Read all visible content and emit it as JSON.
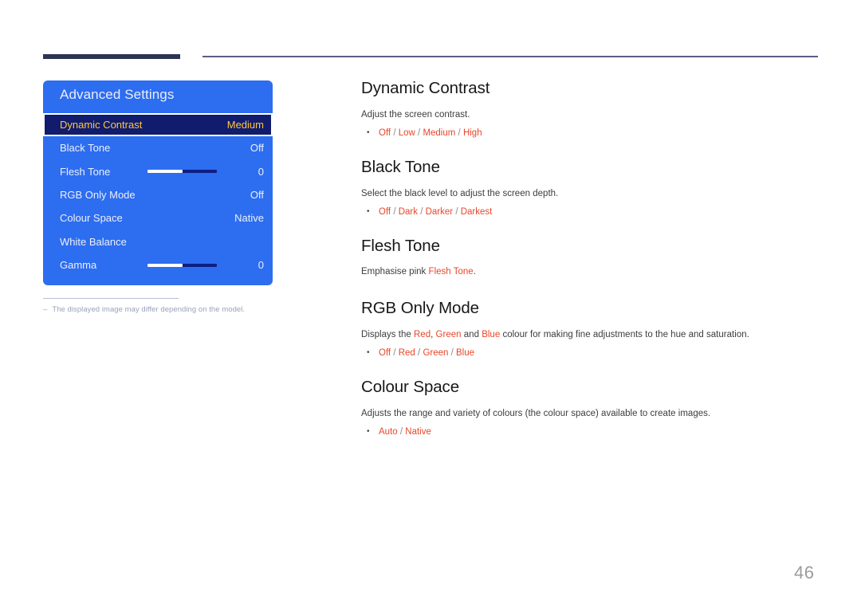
{
  "header": {
    "rule_thick_color": "#2e3553",
    "rule_thin_color": "#5a5f7d"
  },
  "osd": {
    "title": "Advanced Settings",
    "panel_color": "#2d6df0",
    "selected_bg_color": "#111c6e",
    "selected_text_color": "#ffc83d",
    "scroll_indicator": "chevron-down",
    "rows": [
      {
        "label": "Dynamic Contrast",
        "value": "Medium",
        "type": "value",
        "selected": true
      },
      {
        "label": "Black Tone",
        "value": "Off",
        "type": "value",
        "selected": false
      },
      {
        "label": "Flesh Tone",
        "value": "0",
        "type": "slider",
        "fill_percent": 50,
        "selected": false
      },
      {
        "label": "RGB Only Mode",
        "value": "Off",
        "type": "value",
        "selected": false
      },
      {
        "label": "Colour Space",
        "value": "Native",
        "type": "value",
        "selected": false
      },
      {
        "label": "White Balance",
        "value": "",
        "type": "value",
        "selected": false
      },
      {
        "label": "Gamma",
        "value": "0",
        "type": "slider",
        "fill_percent": 50,
        "selected": false
      }
    ]
  },
  "footnote": {
    "dash": "‒",
    "text": "The displayed image may differ depending on the model."
  },
  "content": {
    "accent_color": "#e8462a",
    "sections": [
      {
        "heading": "Dynamic Contrast",
        "desc_parts": [
          {
            "text": "Adjust the screen contrast.",
            "accent": false
          }
        ],
        "options": [
          "Off",
          "Low",
          "Medium",
          "High"
        ],
        "options_separator": " / "
      },
      {
        "heading": "Black Tone",
        "desc_parts": [
          {
            "text": "Select the black level to adjust the screen depth.",
            "accent": false
          }
        ],
        "options": [
          "Off",
          "Dark",
          "Darker",
          "Darkest"
        ],
        "options_separator": " / "
      },
      {
        "heading": "Flesh Tone",
        "desc_parts": [
          {
            "text": "Emphasise pink ",
            "accent": false
          },
          {
            "text": "Flesh Tone",
            "accent": true
          },
          {
            "text": ".",
            "accent": false
          }
        ],
        "options": [],
        "options_separator": " / "
      },
      {
        "heading": "RGB Only Mode",
        "desc_parts": [
          {
            "text": "Displays the ",
            "accent": false
          },
          {
            "text": "Red",
            "accent": true
          },
          {
            "text": ", ",
            "accent": false
          },
          {
            "text": "Green",
            "accent": true
          },
          {
            "text": " and ",
            "accent": false
          },
          {
            "text": "Blue",
            "accent": true
          },
          {
            "text": " colour for making fine adjustments to the hue and saturation.",
            "accent": false
          }
        ],
        "options": [
          "Off",
          "Red",
          "Green",
          "Blue"
        ],
        "options_separator": " / "
      },
      {
        "heading": "Colour Space",
        "desc_parts": [
          {
            "text": "Adjusts the range and variety of colours (the colour space) available to create images.",
            "accent": false
          }
        ],
        "options": [
          "Auto",
          "Native"
        ],
        "options_separator": " / "
      }
    ]
  },
  "page_number": "46"
}
